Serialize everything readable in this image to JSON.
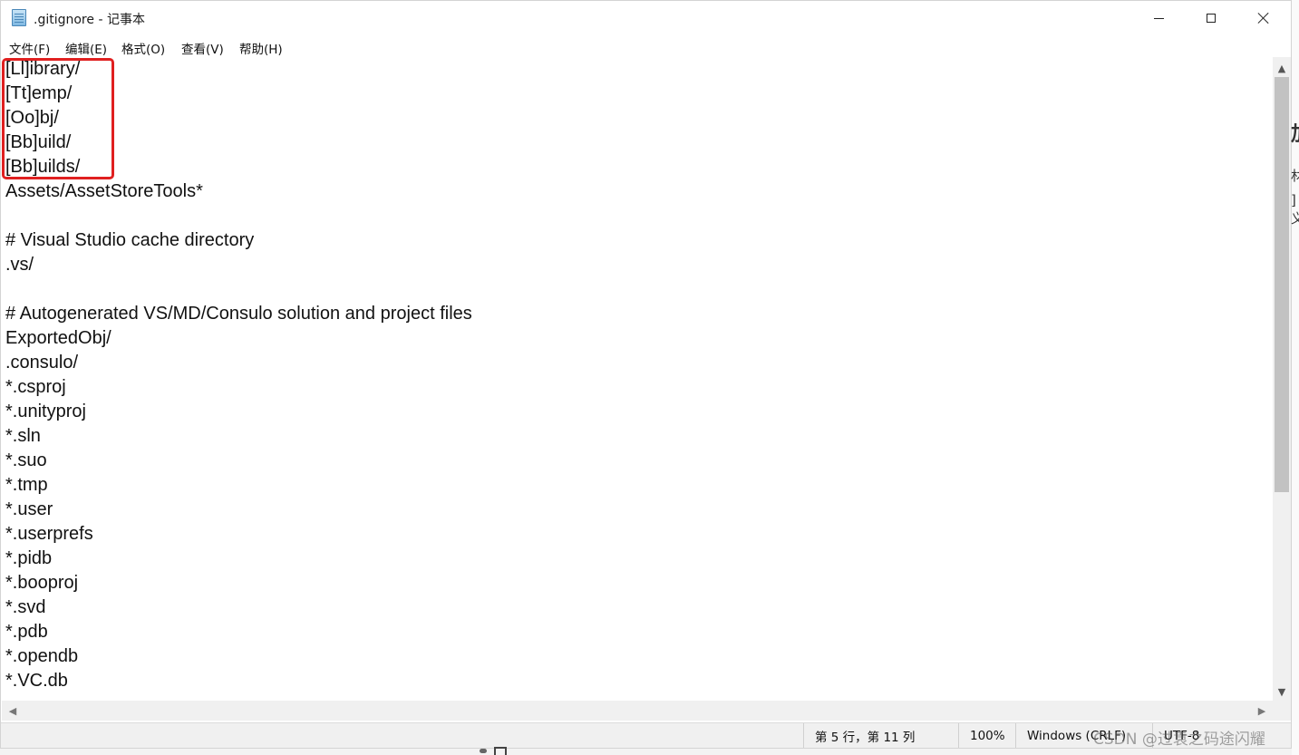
{
  "window": {
    "title": ".gitignore - 记事本",
    "app_icon": "notepad-icon"
  },
  "menu": [
    {
      "label": "文件(F)"
    },
    {
      "label": "编辑(E)"
    },
    {
      "label": "格式(O)"
    },
    {
      "label": "查看(V)"
    },
    {
      "label": "帮助(H)"
    }
  ],
  "editor": {
    "lines": [
      "[Ll]ibrary/",
      "[Tt]emp/",
      "[Oo]bj/",
      "[Bb]uild/",
      "[Bb]uilds/",
      "Assets/AssetStoreTools*",
      "",
      "# Visual Studio cache directory",
      ".vs/",
      "",
      "# Autogenerated VS/MD/Consulo solution and project files",
      "ExportedObj/",
      ".consulo/",
      "*.csproj",
      "*.unityproj",
      "*.sln",
      "*.suo",
      "*.tmp",
      "*.user",
      "*.userprefs",
      "*.pidb",
      "*.booproj",
      "*.svd",
      "*.pdb",
      "*.opendb",
      "*.VC.db"
    ],
    "highlight_color": "#e02020"
  },
  "status": {
    "position": "第 5 行，第 11 列",
    "zoom": "100%",
    "line_ending": "Windows (CRLF)",
    "encoding": "UTF-8"
  },
  "watermark": "CSDN @过袁之码途闪耀",
  "background_glyphs": [
    "加",
    "材",
    "]义"
  ]
}
